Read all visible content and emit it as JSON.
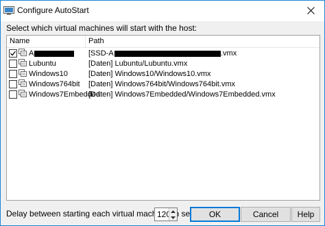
{
  "window": {
    "title": "Configure AutoStart",
    "close_label": "✕"
  },
  "prompt": "Select which virtual machines will start with the host:",
  "list": {
    "columns": {
      "name": "Name",
      "path": "Path"
    },
    "rows": [
      {
        "checked": true,
        "name": "A",
        "path_prefix": "[SSD-A",
        "path_suffix": ".vmx"
      },
      {
        "checked": false,
        "name": "Lubuntu",
        "path": "[Daten] Lubuntu/Lubuntu.vmx"
      },
      {
        "checked": false,
        "name": "Windows10",
        "path": "[Daten] Windows10/Windows10.vmx"
      },
      {
        "checked": false,
        "name": "Windows764bit",
        "path": "[Daten] Windows764bit/Windows764bit.vmx"
      },
      {
        "checked": false,
        "name": "Windows7Embedded",
        "path": "[Daten] Windows7Embedded/Windows7Embedded.vmx"
      }
    ]
  },
  "delay": {
    "label": "Delay between starting each virtual machine (in seconds):",
    "value": "120"
  },
  "buttons": {
    "ok": "OK",
    "cancel": "Cancel",
    "help": "Help"
  },
  "colors": {
    "accent": "#0078d7",
    "window_border": "#1883d7"
  }
}
